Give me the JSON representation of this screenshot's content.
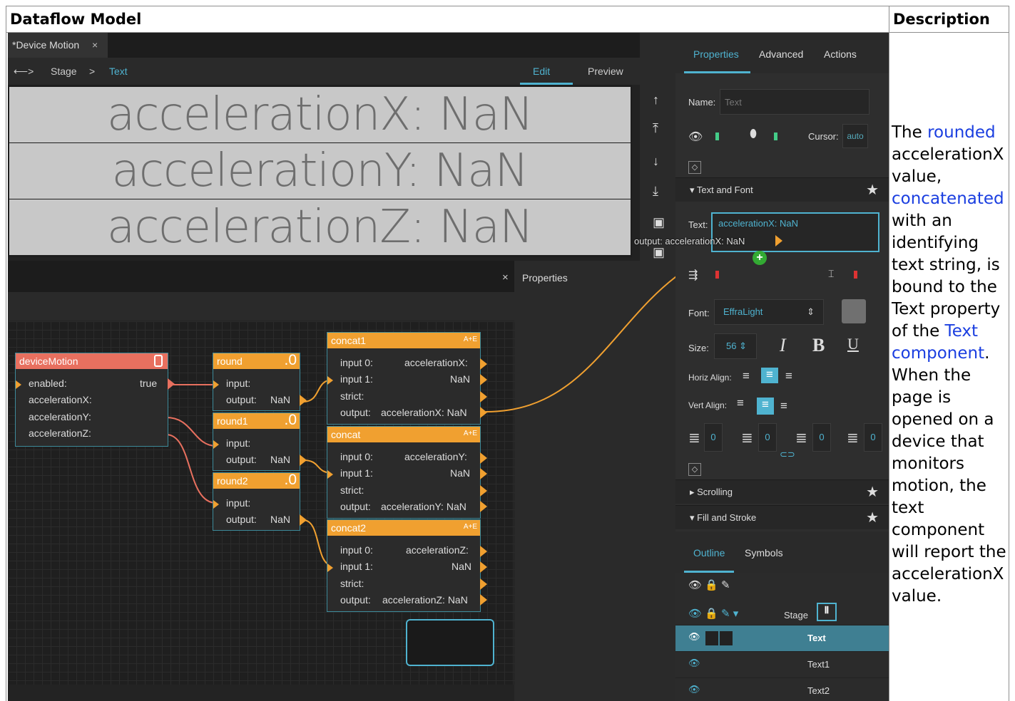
{
  "table": {
    "header_left": "Dataflow Model",
    "header_right": "Description"
  },
  "editor": {
    "tab_title": "*Device Motion",
    "tab_close": "×",
    "breadcrumb": {
      "arrow": "⟵>",
      "stage": "Stage",
      "sep": ">",
      "current": "Text"
    },
    "mode_edit": "Edit",
    "mode_preview": "Preview",
    "canvas_rows": [
      "accelerationX: NaN",
      "accelerationY: NaN",
      "accelerationZ: NaN"
    ],
    "output_tip": {
      "label": "output:",
      "value": "accelerationX: NaN"
    },
    "properties_label": "Properties",
    "close_glyph": "×"
  },
  "nodes": {
    "deviceMotion": {
      "title": "deviceMotion",
      "rows": [
        {
          "label": "enabled:",
          "value": "true"
        },
        {
          "label": "accelerationX:"
        },
        {
          "label": "accelerationY:"
        },
        {
          "label": "accelerationZ:"
        }
      ]
    },
    "round": {
      "title": "round",
      "badge": ".0",
      "input": "input:",
      "output": "output:",
      "value": "NaN"
    },
    "round1": {
      "title": "round1",
      "badge": ".0",
      "input": "input:",
      "output": "output:",
      "value": "NaN"
    },
    "round2": {
      "title": "round2",
      "badge": ".0",
      "input": "input:",
      "output": "output:",
      "value": "NaN"
    },
    "concat1": {
      "title": "concat1",
      "badge": "A+E",
      "in0": "input 0:",
      "in0v": "accelerationX:",
      "in1": "input 1:",
      "in1v": "NaN",
      "strict": "strict:",
      "out": "output:",
      "outv": "accelerationX: NaN"
    },
    "concat": {
      "title": "concat",
      "badge": "A+E",
      "in0": "input 0:",
      "in0v": "accelerationY:",
      "in1": "input 1:",
      "in1v": "NaN",
      "strict": "strict:",
      "out": "output:",
      "outv": "accelerationY: NaN"
    },
    "concat2": {
      "title": "concat2",
      "badge": "A+E",
      "in0": "input 0:",
      "in0v": "accelerationZ:",
      "in1": "input 1:",
      "in1v": "NaN",
      "strict": "strict:",
      "out": "output:",
      "outv": "accelerationZ: NaN"
    }
  },
  "panel": {
    "tabs": [
      "Properties",
      "Advanced",
      "Actions"
    ],
    "name_label": "Name:",
    "name_placeholder": "Text",
    "cursor_label": "Cursor:",
    "cursor_value": "auto",
    "section_text_font": "Text and Font",
    "text_label": "Text:",
    "text_value": "accelerationX: NaN",
    "font_label": "Font:",
    "font_value": "EffraLight",
    "size_label": "Size:",
    "size_value": "56",
    "italic": "I",
    "bold": "B",
    "underline": "U",
    "horiz_label": "Horiz Align:",
    "vert_label": "Vert Align:",
    "spacing_values": [
      "0",
      "0",
      "0",
      "0"
    ],
    "section_scrolling": "Scrolling",
    "section_fill": "Fill and Stroke",
    "outline_tabs": [
      "Outline",
      "Symbols"
    ],
    "stage_label": "Stage",
    "outline_items": [
      "Text",
      "Text1",
      "Text2"
    ]
  },
  "description": {
    "t1": "The ",
    "link_rounded": "rounded",
    "t2": " accelerationX value, ",
    "link_concat": "concatenated",
    "t3": " with an identifying text string, is bound to the Text property of the ",
    "link_text": "Text component",
    "t4": ". When the page is opened on a device that monitors motion, the text component will report the accelerationX value."
  },
  "colors": {
    "accent": "#4fb3d0",
    "node_orange": "#f0a030",
    "node_red": "#e8705f",
    "wire": "#e8705f"
  }
}
